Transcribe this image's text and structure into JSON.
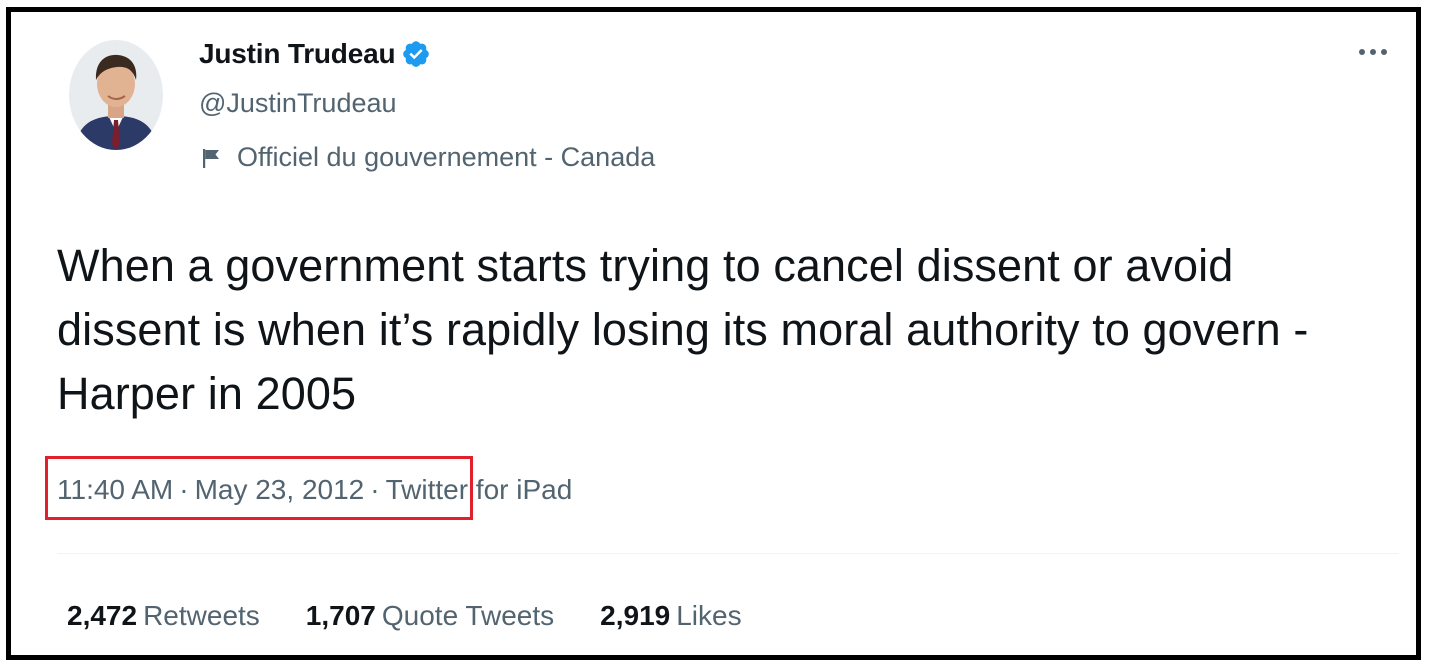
{
  "author": {
    "display_name": "Justin Trudeau",
    "handle": "@JustinTrudeau",
    "verified": true,
    "label": "Officiel du gouvernement - Canada",
    "avatar_icon": "profile-photo"
  },
  "tweet": {
    "text": "When a government starts trying to cancel dissent or avoid dissent is when it’s rapidly losing its moral authority to govern -Harper in 2005",
    "time": "11:40 AM",
    "date": "May 23, 2012",
    "separator": "·",
    "source": "Twitter for iPad"
  },
  "stats": {
    "retweets": {
      "count": "2,472",
      "label": "Retweets"
    },
    "quote_tweets": {
      "count": "1,707",
      "label": "Quote Tweets"
    },
    "likes": {
      "count": "2,919",
      "label": "Likes"
    }
  },
  "colors": {
    "text_primary": "#0f1419",
    "text_secondary": "#536471",
    "verified_blue": "#1d9bf0",
    "highlight_red": "#e0202a",
    "frame_border": "#000000"
  },
  "icons": {
    "verified": "verified-badge-icon",
    "label": "government-flag-icon",
    "more": "more-options-icon"
  }
}
